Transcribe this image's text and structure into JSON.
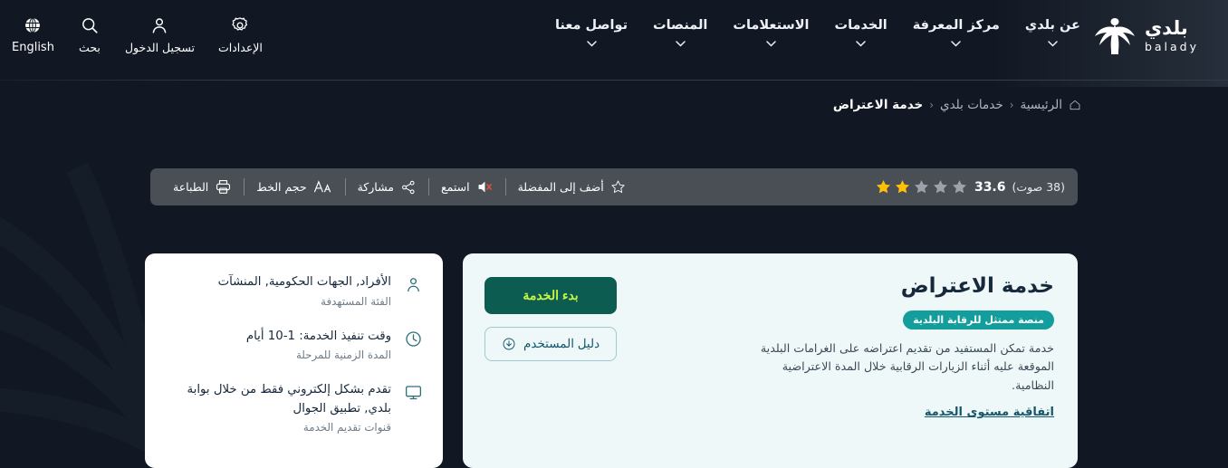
{
  "brand": {
    "name_ar": "بلدي",
    "name_en": "balady",
    "logo_icon": "palm-tree-icon"
  },
  "nav": {
    "items": [
      {
        "label": "عن بلدي",
        "icon": "chevron-down-icon"
      },
      {
        "label": "مركز المعرفة",
        "icon": "chevron-down-icon"
      },
      {
        "label": "الخدمات",
        "icon": "chevron-down-icon"
      },
      {
        "label": "الاستعلامات",
        "icon": "chevron-down-icon"
      },
      {
        "label": "المنصات",
        "icon": "chevron-down-icon"
      },
      {
        "label": "تواصل معنا",
        "icon": "chevron-down-icon"
      }
    ]
  },
  "utils": {
    "items": [
      {
        "label": "الإعدادات",
        "icon": "gear-icon"
      },
      {
        "label": "تسجيل الدخول",
        "icon": "user-icon"
      },
      {
        "label": "بحث",
        "icon": "search-icon"
      },
      {
        "label": "English",
        "icon": "globe-icon"
      }
    ]
  },
  "breadcrumb": {
    "home_icon": "home-icon",
    "items": [
      {
        "label": "الرئيسية",
        "current": false
      },
      {
        "label": "خدمات بلدي",
        "current": false
      },
      {
        "label": "خدمة الاعتراض",
        "current": true
      }
    ],
    "separator": "‹"
  },
  "actionbar": {
    "rating": {
      "value": "33.6",
      "votes_label": "(38 صوت)",
      "stars_total": 5,
      "stars_filled": 2,
      "star_filled_color": "#ffc107",
      "star_empty_color": "#9aa2ab"
    },
    "actions": [
      {
        "label": "أضف إلى المفضلة",
        "icon": "star-outline-icon"
      },
      {
        "label": "استمع",
        "icon": "speaker-muted-icon"
      },
      {
        "label": "مشاركة",
        "icon": "share-nodes-icon"
      },
      {
        "label": "حجم الخط",
        "icon": "font-size-icon"
      },
      {
        "label": "الطباعة",
        "icon": "printer-icon"
      }
    ]
  },
  "service": {
    "title": "خدمة الاعتراض",
    "badge": "منصة ممتثل للرقابة البلدية",
    "description": "خدمة تمكن المستفيد من تقديم اعتراضه على الغرامات البلدية الموقعة عليه أثناء الزيارات الرقابية خلال المدة الاعتراضية النظامية.",
    "sla_link": "اتفاقية مستوى الخدمة",
    "start_button": "بدء الخدمة",
    "guide_button": "دليل المستخدم",
    "guide_icon": "download-circle-icon"
  },
  "info": {
    "rows": [
      {
        "icon": "user-icon",
        "main": "الأفراد, الجهات الحكومية, المنشآت",
        "sub": "الفئة المستهدفة"
      },
      {
        "icon": "clock-icon",
        "main": "وقت تنفيذ الخدمة: 1-10 أيام",
        "sub": "المدة الزمنية للمرحلة"
      },
      {
        "icon": "monitor-icon",
        "main": "تقدم بشكل إلكتروني فقط من خلال بوابة بلدي, تطبيق الجوال",
        "sub": "قنوات تقديم الخدمة"
      }
    ]
  },
  "colors": {
    "background": "#111823",
    "actionbar": "#4a4f56",
    "card_main": "#eff8f8",
    "card_side": "#ffffff",
    "badge": "#149d9d",
    "primary_button_bg": "#0c5c52",
    "primary_button_text": "#c6f542",
    "link": "#16566b"
  }
}
